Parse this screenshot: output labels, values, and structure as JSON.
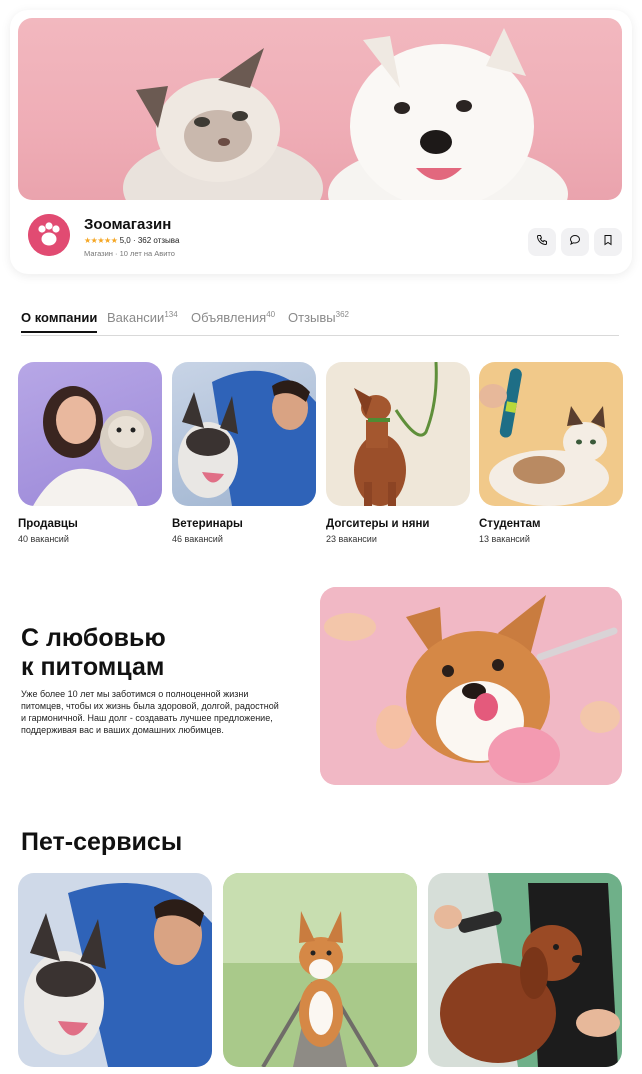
{
  "shop": {
    "name": "Зоомагазин",
    "stars": "★★★★★",
    "rating": "5,0",
    "reviews_text": "362 отзыва",
    "meta": "Магазин · 10 лет на Авито"
  },
  "header_actions": [
    {
      "icon": "phone-icon"
    },
    {
      "icon": "chat-icon"
    },
    {
      "icon": "bookmark-icon"
    }
  ],
  "tabs": [
    {
      "label": "О компании",
      "count": ""
    },
    {
      "label": "Вакансии",
      "count": "134"
    },
    {
      "label": "Объявления",
      "count": "40"
    },
    {
      "label": "Отзывы",
      "count": "362"
    }
  ],
  "categories": [
    {
      "title": "Продавцы",
      "subtitle": "40 вакансий"
    },
    {
      "title": "Ветеринары",
      "subtitle": "46 вакансий"
    },
    {
      "title": "Догситеры и няни",
      "subtitle": "23 вакансии"
    },
    {
      "title": "Студентам",
      "subtitle": "13 вакансий"
    }
  ],
  "love": {
    "title_line1": "С любовью",
    "title_line2": "к питомцам",
    "text": "Уже более 10 лет мы заботимся о полноценной жизни питомцев, чтобы их жизнь была здоровой, долгой, радостной и гармоничной. Наш долг - создавать лучшее предложение, поддерживая вас и ваших домашних любимцев."
  },
  "services": {
    "title": "Пет-сервисы"
  },
  "colors": {
    "brand_pink": "#e14b72",
    "banner_pink": "#efadb6",
    "star": "#f5a623"
  }
}
